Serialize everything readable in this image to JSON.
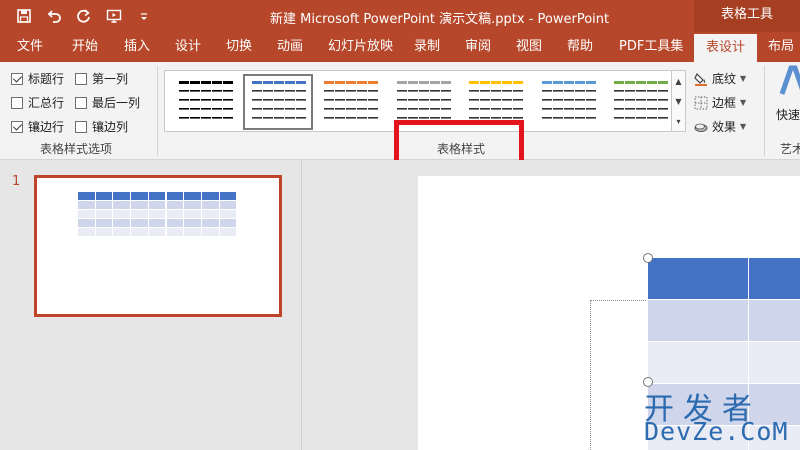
{
  "titlebar": {
    "document_title": "新建 Microsoft PowerPoint 演示文稿.pptx  -  PowerPoint",
    "context_header": "表格工具",
    "qat": [
      "save-icon",
      "undo-icon",
      "redo-icon",
      "present-from-start-icon",
      "customize-qat-icon"
    ]
  },
  "tabs": [
    "文件",
    "开始",
    "插入",
    "设计",
    "切换",
    "动画",
    "幻灯片放映",
    "录制",
    "审阅",
    "视图",
    "帮助",
    "PDF工具集",
    "表设计",
    "布局"
  ],
  "active_tab": "表设计",
  "style_options": {
    "group_label": "表格样式选项",
    "options": [
      {
        "label": "标题行",
        "checked": true
      },
      {
        "label": "第一列",
        "checked": false
      },
      {
        "label": "汇总行",
        "checked": false
      },
      {
        "label": "最后一列",
        "checked": false
      },
      {
        "label": "镶边行",
        "checked": true
      },
      {
        "label": "镶边列",
        "checked": false
      }
    ]
  },
  "table_styles": {
    "group_label": "表格样式",
    "swatch_colors": [
      "#000000",
      "#4472c4",
      "#ed7d31",
      "#a5a5a5",
      "#ffc000",
      "#5b9bd5",
      "#70ad47"
    ],
    "selected_index": 1,
    "commands": [
      {
        "label": "底纹",
        "icon": "shading-icon"
      },
      {
        "label": "边框",
        "icon": "borders-icon"
      },
      {
        "label": "效果",
        "icon": "effects-icon"
      }
    ]
  },
  "wordart": {
    "quick_styles_label": "快速",
    "group_label": "艺术"
  },
  "slides_pane": {
    "slide_number": "1"
  },
  "watermark": {
    "cn": "开发者",
    "en": "DevZe.CoM"
  },
  "colors": {
    "accent": "#b7472a",
    "table_header": "#4472c4",
    "table_band_dark": "#cfd5ea",
    "table_band_light": "#e9ebf5",
    "highlight": "#e3141c"
  }
}
